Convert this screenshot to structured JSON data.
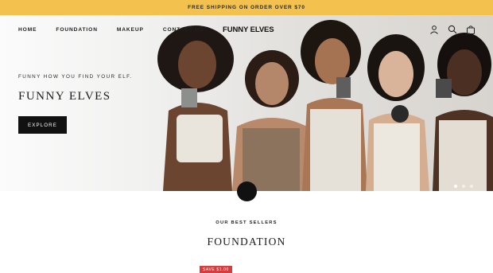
{
  "announcement": {
    "text": "FREE SHIPPING ON ORDER OVER $70"
  },
  "nav": {
    "links": [
      {
        "label": "HOME"
      },
      {
        "label": "FOUNDATION"
      },
      {
        "label": "MAKEUP"
      },
      {
        "label": "CONTACT US"
      }
    ],
    "logo": "FUNNY ELVES",
    "icons": [
      "account-icon",
      "search-icon",
      "cart-icon"
    ]
  },
  "hero": {
    "kicker": "FUNNY HOW YOU FIND YOUR ELF.",
    "headline": "FUNNY ELVES",
    "button_label": "EXPLORE",
    "slide_count": 3,
    "active_slide": 1
  },
  "best_sellers": {
    "label": "OUR BEST SELLERS",
    "title": "FOUNDATION",
    "badge": "SAVE $1.00"
  },
  "colors": {
    "announcement_bg": "#f2c14e",
    "button_bg": "#111111",
    "sale_badge": "#d63c3c"
  }
}
